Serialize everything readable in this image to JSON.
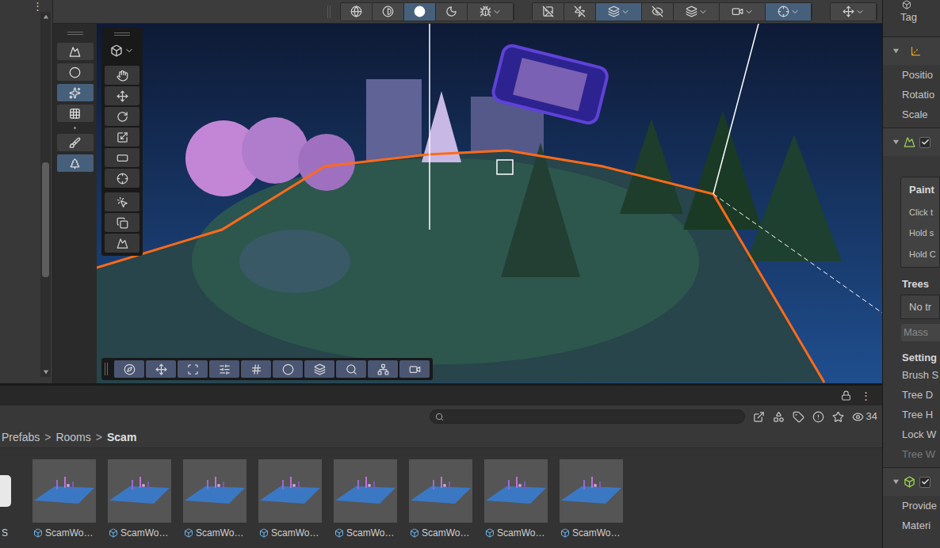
{
  "hierarchy": {
    "menu": "⋮"
  },
  "scene_toolbar": {
    "groups": [
      [
        {
          "selected": false,
          "dropdown": false
        },
        {
          "selected": false,
          "dropdown": false
        },
        {
          "selected": true,
          "dropdown": false
        },
        {
          "selected": false,
          "dropdown": false
        },
        {
          "selected": false,
          "dropdown": true
        }
      ],
      [
        {
          "selected": false,
          "dropdown": false
        },
        {
          "selected": false,
          "dropdown": false
        },
        {
          "selected": true,
          "dropdown": true
        },
        {
          "selected": false,
          "dropdown": false
        },
        {
          "selected": false,
          "dropdown": true
        },
        {
          "selected": false,
          "dropdown": true
        },
        {
          "selected": true,
          "dropdown": true
        }
      ],
      [
        {
          "selected": false,
          "dropdown": true
        }
      ]
    ]
  },
  "terrain_tools": [
    {
      "selected": false
    },
    {
      "selected": false
    },
    {
      "selected": true
    },
    {
      "selected": false
    },
    {
      "selected": false
    },
    {
      "selected": true
    }
  ],
  "tool_palette": {
    "view_dropdown": true,
    "tools": [
      {
        "selected": false
      },
      {
        "selected": false
      },
      {
        "selected": false
      },
      {
        "selected": false
      },
      {
        "selected": false
      },
      {
        "selected": false
      },
      {
        "selected": false
      },
      {
        "selected": false
      },
      {
        "selected": false
      }
    ]
  },
  "overlay_toolbar": [
    {
      "selected": true
    },
    {
      "selected": true
    },
    {
      "selected": true
    },
    {
      "selected": true
    },
    {
      "selected": true
    },
    {
      "selected": true
    },
    {
      "selected": true
    },
    {
      "selected": true
    },
    {
      "selected": true
    },
    {
      "selected": true
    }
  ],
  "inspector": {
    "rows": [
      {
        "kind": "tag",
        "text": "Tag"
      },
      {
        "kind": "header",
        "expanded": true,
        "toggle": false,
        "checked": false
      },
      {
        "kind": "field",
        "text": "Positio",
        "disabled": false
      },
      {
        "kind": "field",
        "text": "Rotatio",
        "disabled": false
      },
      {
        "kind": "field",
        "text": "Scale",
        "disabled": false
      },
      {
        "kind": "header",
        "expanded": true,
        "toggle": true,
        "checked": true
      },
      {
        "kind": "helpbox",
        "title": "Paint",
        "lines": [
          "Click t",
          "Hold s",
          "Hold C"
        ]
      },
      {
        "kind": "heading",
        "text": "Trees"
      },
      {
        "kind": "list",
        "text": "No tr"
      },
      {
        "kind": "button",
        "text": "Mass",
        "disabled": true
      },
      {
        "kind": "heading",
        "text": "Setting"
      },
      {
        "kind": "field",
        "text": "Brush S",
        "disabled": false
      },
      {
        "kind": "field",
        "text": "Tree D",
        "disabled": false
      },
      {
        "kind": "field",
        "text": "Tree H",
        "disabled": false
      },
      {
        "kind": "field",
        "text": "Lock W",
        "disabled": false
      },
      {
        "kind": "field",
        "text": "Tree W",
        "disabled": true
      },
      {
        "kind": "header",
        "expanded": true,
        "toggle": true,
        "checked": true
      },
      {
        "kind": "field",
        "text": "Provide",
        "disabled": false
      },
      {
        "kind": "field",
        "text": "Materi",
        "disabled": false
      }
    ]
  },
  "project": {
    "menu": "⋮",
    "locked": false,
    "visible_count": "34",
    "separator": ">",
    "breadcrumb": [
      {
        "label": "Prefabs",
        "current": false
      },
      {
        "label": "Rooms",
        "current": false
      },
      {
        "label": "Scam",
        "current": true
      }
    ],
    "items": [
      {
        "label": "S",
        "kind": "scene"
      },
      {
        "label": "ScamWo…",
        "kind": "prefab"
      },
      {
        "label": "ScamWo…",
        "kind": "prefab"
      },
      {
        "label": "ScamWo…",
        "kind": "prefab"
      },
      {
        "label": "ScamWo…",
        "kind": "prefab"
      },
      {
        "label": "ScamWo…",
        "kind": "prefab"
      },
      {
        "label": "ScamWo…",
        "kind": "prefab"
      },
      {
        "label": "ScamWo…",
        "kind": "prefab"
      },
      {
        "label": "ScamWo…",
        "kind": "prefab"
      }
    ]
  }
}
